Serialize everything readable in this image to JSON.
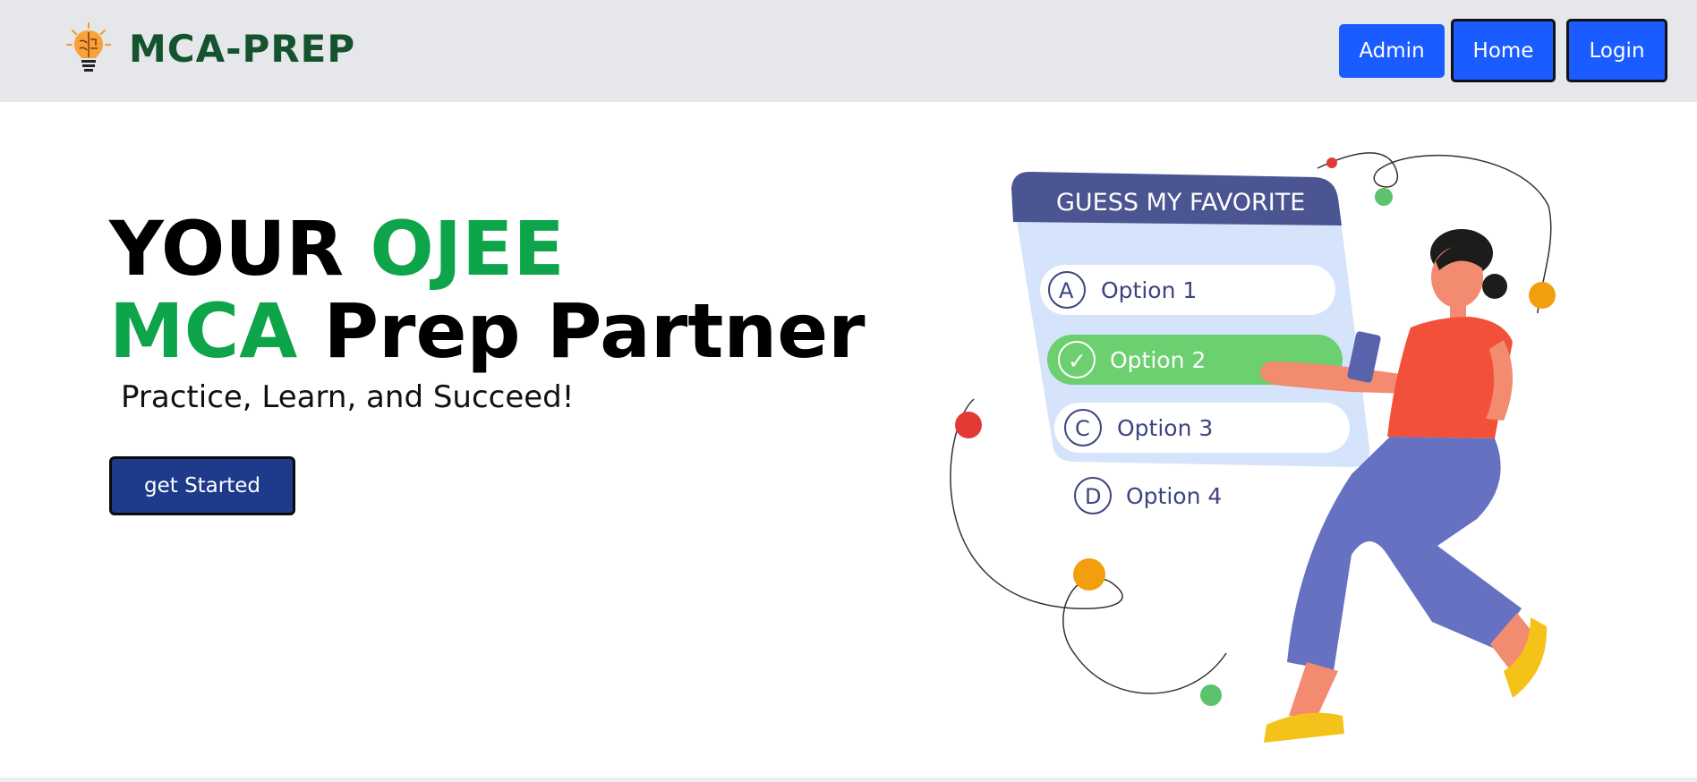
{
  "header": {
    "brand_name": "MCA-PREP",
    "logo_icon": "lightbulb-brain-icon",
    "nav": {
      "admin_label": "Admin",
      "home_label": "Home",
      "login_label": "Login"
    }
  },
  "hero": {
    "title_part1": "YOUR ",
    "title_accent1": "OJEE",
    "title_accent2": "MCA",
    "title_part2": " Prep Partner",
    "subtitle": "Practice, Learn, and Succeed!",
    "cta_label": "get Started"
  },
  "illustration": {
    "card_title": "GUESS MY FAVORITE",
    "options": [
      {
        "letter": "A",
        "label": "Option 1"
      },
      {
        "letter": "✓",
        "label": "Option 2"
      },
      {
        "letter": "C",
        "label": "Option 3"
      },
      {
        "letter": "D",
        "label": "Option 4"
      }
    ]
  },
  "colors": {
    "brand_green": "#14532d",
    "accent_green": "#0ea44a",
    "nav_blue": "#1a5cff",
    "cta_navy": "#1e3a8a",
    "header_bg": "#e5e7eb"
  }
}
